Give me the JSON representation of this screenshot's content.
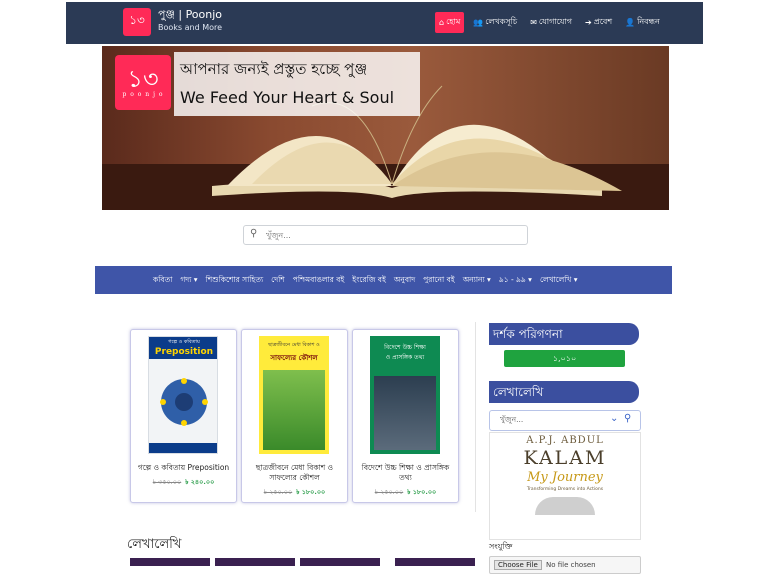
{
  "header": {
    "brand_logo_text": "১৩",
    "brand_title": "পুঞ্জ | Poonjo",
    "brand_subtitle": "Books and More",
    "nav": [
      {
        "label": "হোম",
        "icon": "home-icon",
        "active": true
      },
      {
        "label": "লেখকসূচি",
        "icon": "users-icon",
        "active": false
      },
      {
        "label": "যোগাযোগ",
        "icon": "envelope-icon",
        "active": false
      },
      {
        "label": "প্রবেশ",
        "icon": "sign-in-icon",
        "active": false
      },
      {
        "label": "নিবন্ধন",
        "icon": "user-plus-icon",
        "active": false
      }
    ]
  },
  "hero": {
    "logo_glyph": "১৩",
    "logo_text": "p o o n j o",
    "line1": "আপনার জন্যই প্রস্তুত হচ্ছে পুঞ্জ",
    "line2": "We Feed Your Heart & Soul"
  },
  "search": {
    "placeholder": "খুঁজুন..."
  },
  "categories": [
    {
      "label": "কবিতা",
      "dropdown": false
    },
    {
      "label": "গদ্য",
      "dropdown": true
    },
    {
      "label": "শিশুকিশোর সাহিত্য",
      "dropdown": false
    },
    {
      "label": "দেশি",
      "dropdown": false
    },
    {
      "label": "পশ্চিমবাঙলার বই",
      "dropdown": false
    },
    {
      "label": "ইংরেজি বই",
      "dropdown": false
    },
    {
      "label": "অনুবাদ",
      "dropdown": false
    },
    {
      "label": "পুরানো বই",
      "dropdown": false
    },
    {
      "label": "অন্যান্য",
      "dropdown": true
    },
    {
      "label": "৯১ - ৯৯",
      "dropdown": true
    },
    {
      "label": "লেখালেখি",
      "dropdown": true
    }
  ],
  "products": [
    {
      "cover_title": "গল্পে ও কবিতায়",
      "cover_big": "Preposition",
      "name": "গল্পে ও কবিতায় Preposition",
      "old_price": "৳ ৩৫০.০০",
      "price": "৳ ২৪০.০০"
    },
    {
      "cover_title": "ছাত্রজীবনে মেধা বিকাশ ও",
      "cover_big": "সাফল্যের কৌশল",
      "name": "ছাত্রজীবনে মেধা বিকাশ ও সাফল্যের কৌশল",
      "old_price": "৳ ২৫০.০০",
      "price": "৳ ১৮০.০০"
    },
    {
      "cover_title": "বিদেশে উচ্চ শিক্ষা",
      "cover_big": "ও প্রাসঙ্গিক তথ্য",
      "name": "বিদেশে উচ্চ শিক্ষা ও প্রাসঙ্গিক তথ্য",
      "old_price": "৳ ২৫০.০০",
      "price": "৳ ১৮০.০০"
    }
  ],
  "main": {
    "section_title": "লেখালেখি"
  },
  "sidebar": {
    "visitor_title": "দর্শক পরিগণনা",
    "visitor_count": "১,০১০",
    "writing_title": "লেখালেখি",
    "select_placeholder": "খুঁজুন...",
    "book": {
      "author": "A.P.J. ABDUL",
      "title": "KALAM",
      "subtitle": "My Journey",
      "tagline": "Transforming Dreams into Actions"
    },
    "attachment_label": "সংযুক্তি",
    "file_button": "Choose File",
    "file_none": "No file chosen"
  },
  "colors": {
    "navbar": "#2b3a55",
    "accent": "#ff2a57",
    "category_bar": "#3f55a8",
    "counter": "#1fa33f",
    "price": "#2a9d4a"
  }
}
